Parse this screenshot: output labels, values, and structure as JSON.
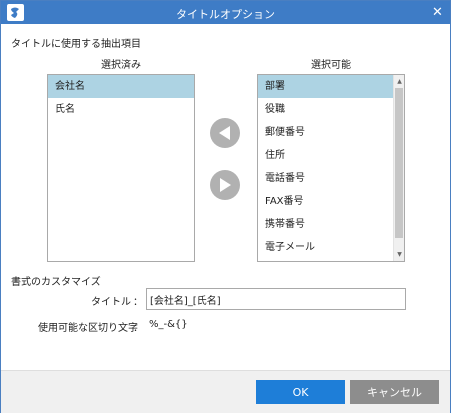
{
  "window": {
    "title": "タイトルオプション",
    "close_glyph": "✕",
    "accent_color": "#3e7cc6"
  },
  "extraction": {
    "section_label": "タイトルに使用する抽出項目",
    "selected_header": "選択済み",
    "available_header": "選択可能",
    "selected_items": [
      "会社名",
      "氏名"
    ],
    "selected_active_index": 0,
    "available_items": [
      "部署",
      "役職",
      "郵便番号",
      "住所",
      "電話番号",
      "FAX番号",
      "携帯番号",
      "電子メール"
    ],
    "available_active_index": 0,
    "move_left_icon": "left-triangle",
    "move_right_icon": "right-triangle"
  },
  "format": {
    "section_label": "書式のカスタマイズ",
    "title_label": "タイトル",
    "colon": "：",
    "title_value": "[会社名]_[氏名]",
    "separators_label": "使用可能な区切り文字",
    "separators_value": "%_-&{}"
  },
  "footer": {
    "ok_label": "OK",
    "cancel_label": "キャンセル",
    "ok_color": "#1e7ed8",
    "cancel_color": "#8d8d8d"
  }
}
